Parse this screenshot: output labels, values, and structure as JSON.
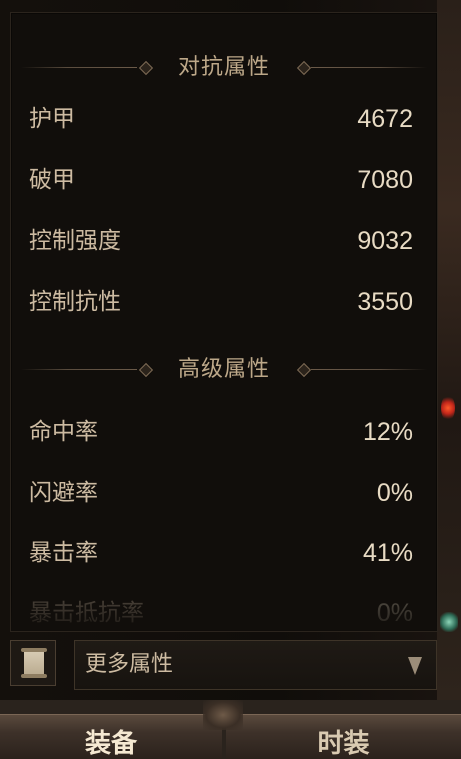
{
  "sections": [
    {
      "title": "对抗属性",
      "stats": [
        {
          "label": "护甲",
          "value": "4672"
        },
        {
          "label": "破甲",
          "value": "7080"
        },
        {
          "label": "控制强度",
          "value": "9032"
        },
        {
          "label": "控制抗性",
          "value": "3550"
        }
      ]
    },
    {
      "title": "高级属性",
      "stats": [
        {
          "label": "命中率",
          "value": "12%"
        },
        {
          "label": "闪避率",
          "value": "0%"
        },
        {
          "label": "暴击率",
          "value": "41%"
        },
        {
          "label": "暴击抵抗率",
          "value": "0%"
        }
      ]
    }
  ],
  "dropdown": {
    "label": "更多属性"
  },
  "tabs": [
    {
      "label": "装备"
    },
    {
      "label": "时装"
    }
  ],
  "icons": {
    "scroll": "scroll-icon",
    "dropdown_arrow": "chevron-down-icon"
  }
}
